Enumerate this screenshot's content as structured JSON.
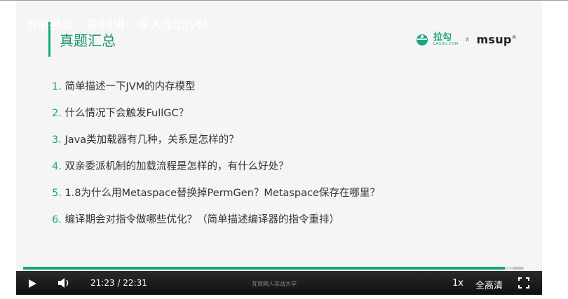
{
  "player": {
    "now_playing": "当前播放：第03讲：深入浅出JVM",
    "progress_fraction": 0.9627,
    "elapsed": "21:23",
    "duration": "22:31",
    "time_text": "21:23 / 22:31",
    "watermark": "互联网人实战大学",
    "speed": "1x",
    "quality": "全高清"
  },
  "slide": {
    "title": "真题汇总",
    "logos": {
      "lagou_name": "拉勾",
      "lagou_sub": "LAGOU.COM",
      "separator": "x",
      "msup": "msup",
      "msup_mark": "®"
    },
    "questions": [
      {
        "num": "1.",
        "text": "简单描述一下JVM的内存模型"
      },
      {
        "num": "2.",
        "text": "什么情况下会触发FullGC？"
      },
      {
        "num": "3.",
        "text": "Java类加载器有几种，关系是怎样的？"
      },
      {
        "num": "4.",
        "text": "双亲委派机制的加载流程是怎样的，有什么好处？"
      },
      {
        "num": "5.",
        "text": "1.8为什么用Metaspace替换掉PermGen？Metaspace保存在哪里？"
      },
      {
        "num": "6.",
        "text": "编译期会对指令做哪些优化？（简单描述编译器的指令重排）"
      }
    ]
  },
  "colors": {
    "accent": "#1aa57f",
    "slide_bg": "#f5f5f5",
    "control_bar": "#1a1a1a",
    "progress_track": "#dcdcdc"
  },
  "icons": [
    "play-icon",
    "volume-icon",
    "fullscreen-icon",
    "lagou-logo-icon"
  ]
}
